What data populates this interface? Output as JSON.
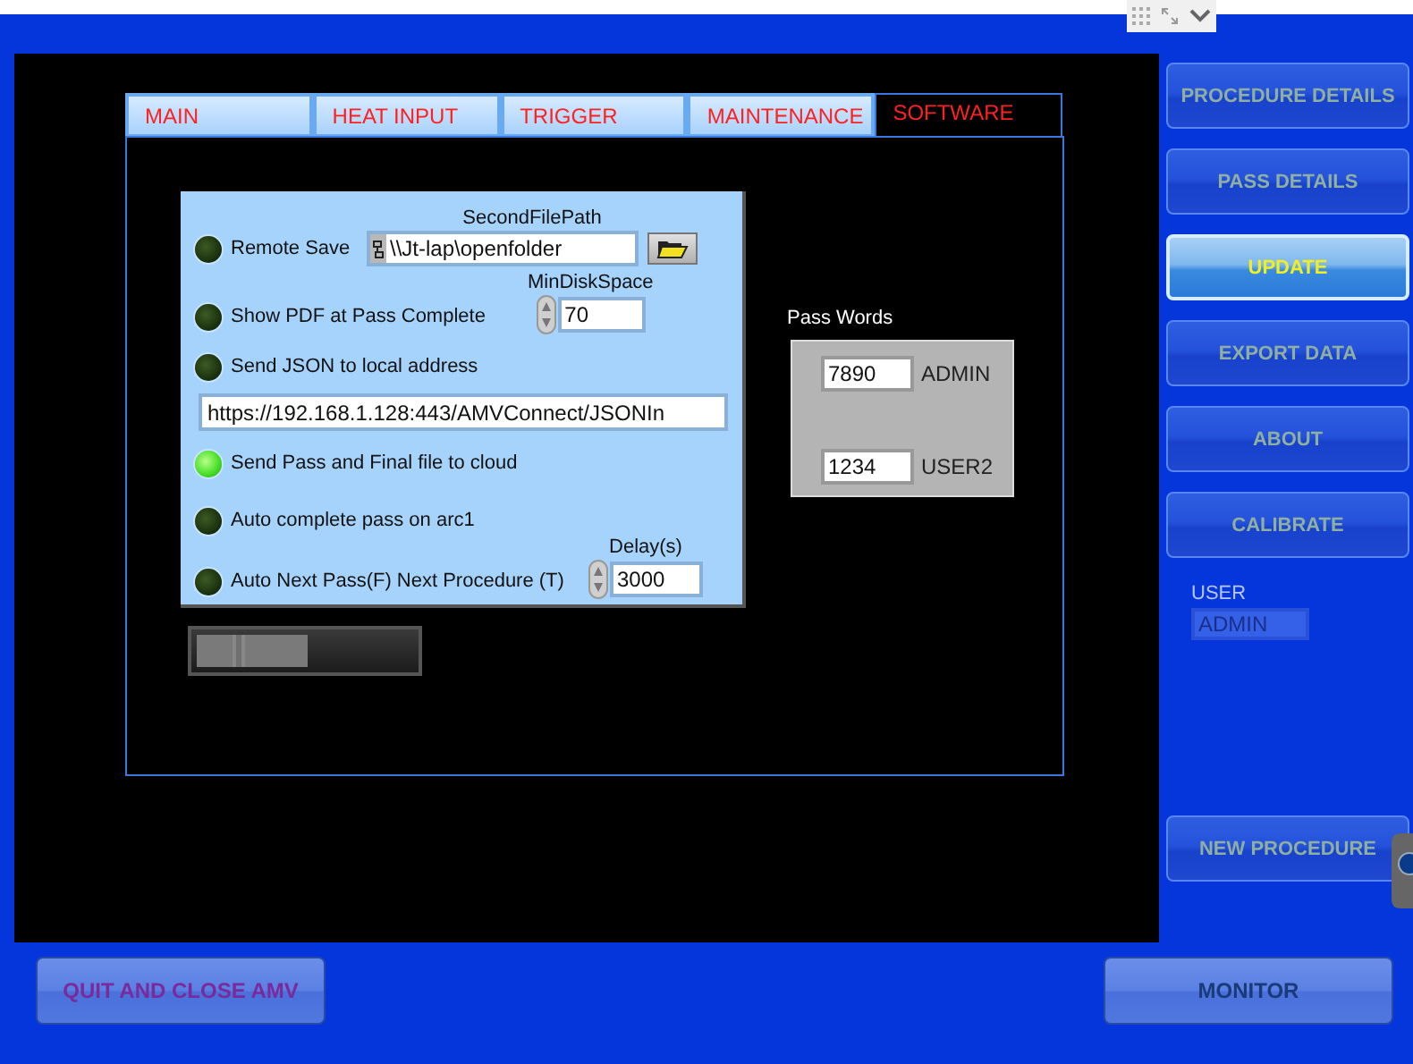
{
  "tabs": [
    {
      "label": "MAIN",
      "selected": false
    },
    {
      "label": "HEAT INPUT",
      "selected": false
    },
    {
      "label": "TRIGGER",
      "selected": false
    },
    {
      "label": "MAINTENANCE",
      "selected": false
    },
    {
      "label": "SOFTWARE",
      "selected": true
    }
  ],
  "indicators": [
    {
      "label": "Remote Save",
      "on": false
    },
    {
      "label": "Show PDF at Pass Complete",
      "on": false
    },
    {
      "label": "Send JSON to local address",
      "on": false
    },
    {
      "label": "Send Pass and Final file to cloud",
      "on": true
    },
    {
      "label": "Auto complete pass on arc1",
      "on": false
    },
    {
      "label": "Auto Next Pass(F) Next Procedure (T)",
      "on": false
    }
  ],
  "second_file_path": {
    "label": "SecondFilePath",
    "value": "\\\\Jt-lap\\openfolder"
  },
  "min_disk_space": {
    "label": "MinDiskSpace",
    "value": "70"
  },
  "json_address": {
    "value": "https://192.168.1.128:443/AMVConnect/JSONIn"
  },
  "delay": {
    "label": "Delay(s)",
    "value": "3000"
  },
  "switch": {
    "on": false
  },
  "pass_words": {
    "title": "Pass Words",
    "entries": [
      {
        "value": "7890",
        "label": "ADMIN"
      },
      {
        "value": "1234",
        "label": "USER2"
      }
    ]
  },
  "sidebar": {
    "items": [
      {
        "label": "PROCEDURE DETAILS",
        "selected": false,
        "disabled": true
      },
      {
        "label": "PASS DETAILS",
        "selected": false,
        "disabled": true
      },
      {
        "label": "UPDATE",
        "selected": true,
        "disabled": false
      },
      {
        "label": "EXPORT DATA",
        "selected": false,
        "disabled": true
      },
      {
        "label": "ABOUT",
        "selected": false,
        "disabled": true
      },
      {
        "label": "CALIBRATE",
        "selected": false,
        "disabled": true
      }
    ],
    "user": {
      "label": "USER",
      "value": "ADMIN"
    },
    "new_procedure": {
      "label": "NEW PROCEDURE",
      "disabled": true
    }
  },
  "bottom_buttons": [
    {
      "label": "QUIT AND CLOSE AMV",
      "kind": "quit"
    },
    {
      "label": "MONITOR",
      "kind": "monitor"
    }
  ]
}
